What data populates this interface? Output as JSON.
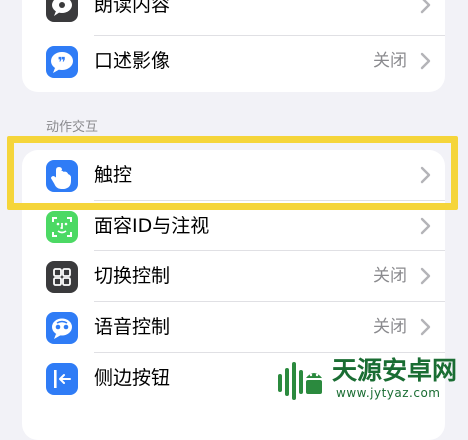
{
  "group1": {
    "items": [
      {
        "label": "朗读内容",
        "value": "",
        "icon": "speech-bubble-icon"
      },
      {
        "label": "口述影像",
        "value": "关闭",
        "icon": "quote-bubble-icon"
      }
    ]
  },
  "section_header": "动作交互",
  "group2": {
    "items": [
      {
        "label": "触控",
        "value": "",
        "icon": "hand-touch-icon"
      },
      {
        "label": "面容ID与注视",
        "value": "",
        "icon": "face-id-icon"
      },
      {
        "label": "切换控制",
        "value": "关闭",
        "icon": "grid-icon"
      },
      {
        "label": "语音控制",
        "value": "关闭",
        "icon": "voice-control-icon"
      },
      {
        "label": "侧边按钮",
        "value": "",
        "icon": "side-button-icon"
      }
    ]
  },
  "watermark": {
    "title": "天源安卓网",
    "url": "www.jytyaz.com"
  },
  "colors": {
    "highlight": "#f5d53a",
    "blue": "#2f7cf6",
    "green": "#4cd964",
    "dark": "#3a3a3c"
  }
}
